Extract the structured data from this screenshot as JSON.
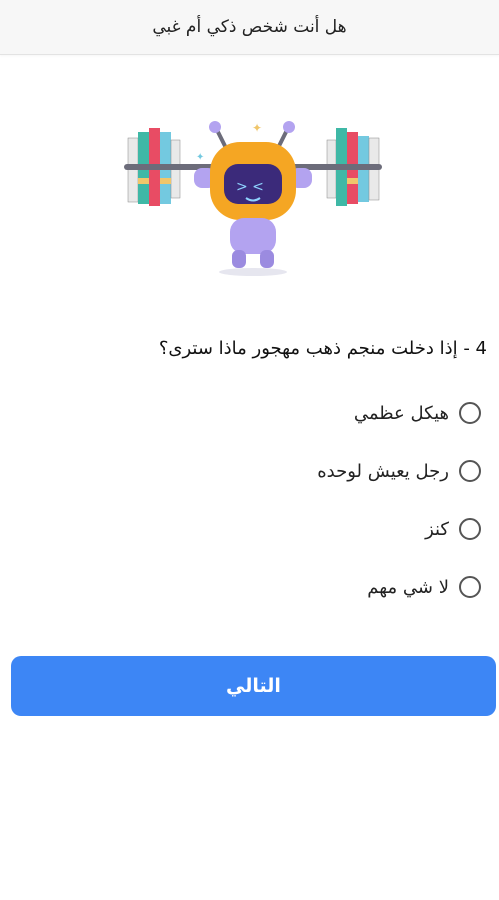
{
  "header": {
    "title": "هل أنت شخص ذكي أم غبي"
  },
  "illustration": {
    "icon": "robot-lifting-books-icon",
    "colors": {
      "robot_head": "#f5a623",
      "robot_body": "#b3a3f0",
      "screen": "#3b2a7a",
      "bar": "#6c6c7a",
      "books": [
        "#e84c64",
        "#3fb8a6",
        "#e9e9e9",
        "#73c9e0",
        "#f0c66b"
      ]
    }
  },
  "question": {
    "text": "4 - إذا دخلت منجم ذهب مهجور ماذا سترى؟"
  },
  "options": [
    {
      "label": "هيكل عظمي",
      "selected": false
    },
    {
      "label": "رجل يعيش لوحده",
      "selected": false
    },
    {
      "label": "كنز",
      "selected": false
    },
    {
      "label": "لا شي مهم",
      "selected": false
    }
  ],
  "actions": {
    "next_label": "التالي"
  },
  "theme": {
    "accent": "#3d86f5",
    "appbar_bg": "#f7f7f7"
  }
}
